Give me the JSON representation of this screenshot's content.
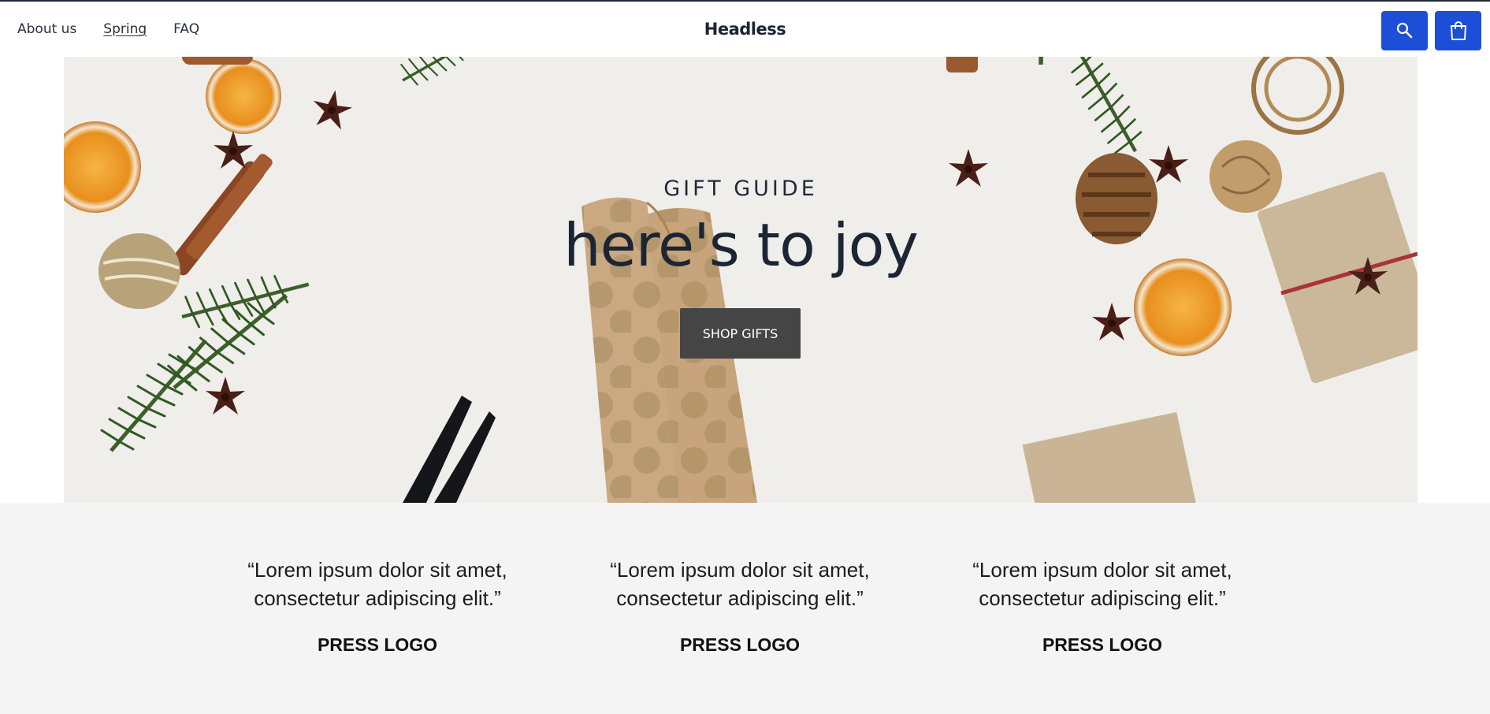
{
  "nav": {
    "items": [
      {
        "label": "About us"
      },
      {
        "label": "Spring"
      },
      {
        "label": "FAQ"
      }
    ]
  },
  "brand": "Headless",
  "header": {
    "search_icon": "search-icon",
    "cart_icon": "shopping-bag-icon",
    "accent": "#1d4ed8"
  },
  "hero": {
    "eyebrow": "GIFT GUIDE",
    "headline": "here's to joy",
    "cta": "SHOP GIFTS"
  },
  "press": [
    {
      "quote": "“Lorem ipsum dolor sit amet, consectetur adipiscing elit.”",
      "logo": "PRESS LOGO"
    },
    {
      "quote": "“Lorem ipsum dolor sit amet, consectetur adipiscing elit.”",
      "logo": "PRESS LOGO"
    },
    {
      "quote": "“Lorem ipsum dolor sit amet, consectetur adipiscing elit.”",
      "logo": "PRESS LOGO"
    }
  ]
}
